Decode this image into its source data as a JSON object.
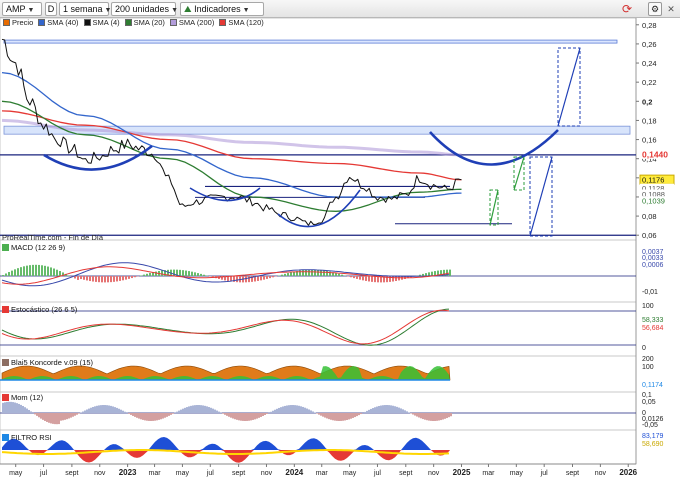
{
  "toolbar": {
    "ticker": "AMP",
    "d_label": "D",
    "period": "1 semana",
    "units": "200 unidades",
    "indicators": "Indicadores"
  },
  "legend": [
    {
      "label": "Precio",
      "color": "#e86b00"
    },
    {
      "label": "SMA (40)",
      "color": "#3366cc"
    },
    {
      "label": "SMA (4)",
      "color": "#111111"
    },
    {
      "label": "SMA (20)",
      "color": "#2e7d32"
    },
    {
      "label": "SMA (200)",
      "color": "#b39ddb"
    },
    {
      "label": "SMA (120)",
      "color": "#e53935"
    }
  ],
  "source_label": "ProRealTime.com - Fin de Día",
  "price_axis": {
    "ticks": [
      "0,28",
      "0,26",
      "0,24",
      "0,22",
      "0,2",
      "0,18",
      "0,16",
      "0,14",
      "0,12",
      "0,1",
      "0,08",
      "0,06"
    ],
    "tags": [
      {
        "text": "0,1440",
        "color": "#e53935",
        "bg": "#ffffff"
      },
      {
        "text": "0,1176",
        "color": "#111111",
        "bg": "#ffeb3b"
      },
      {
        "text": "0,1128",
        "color": "#555555",
        "bg": "#ffffff"
      },
      {
        "text": "0,1088",
        "color": "#555555",
        "bg": "#ffffff"
      },
      {
        "text": "0,1039",
        "color": "#2e7d32",
        "bg": "#ffffff"
      }
    ]
  },
  "x_axis": {
    "labels": [
      "may",
      "jul",
      "sept",
      "nov",
      "2023",
      "mar",
      "may",
      "jul",
      "sept",
      "nov",
      "2024",
      "mar",
      "may",
      "jul",
      "sept",
      "nov",
      "2025",
      "mar",
      "may",
      "jul",
      "sept",
      "nov",
      "2026"
    ]
  },
  "panels": {
    "macd": {
      "label": "MACD (12 26 9)",
      "ticks": [
        "0,0037",
        "0,0033",
        "0,0006",
        "-0,01"
      ]
    },
    "stoch": {
      "label": "Estocástico (26 6 5)",
      "ticks": [
        "100",
        "58,333",
        "56,684",
        "0"
      ]
    },
    "koncorde": {
      "label": "Blai5 Koncorde v.09 (15)",
      "ticks": [
        "200",
        "100",
        "0,1174"
      ]
    },
    "mom": {
      "label": "Mom (12)",
      "ticks": [
        "0,1",
        "0,05",
        "0",
        "0,0126",
        "-0,05"
      ]
    },
    "rsi": {
      "label": "FILTRO RSI",
      "ticks": [
        "83,179",
        "58,690"
      ]
    }
  },
  "chart_data": {
    "type": "line",
    "title": "AMP",
    "period": "1 semana",
    "x_range": [
      "2022-04",
      "2026-02"
    ],
    "ylim": [
      0.055,
      0.285
    ],
    "series": [
      {
        "name": "Precio",
        "x": [
          "2022-04",
          "2022-05",
          "2022-06",
          "2022-07",
          "2022-08",
          "2022-09",
          "2022-10",
          "2022-11",
          "2022-12",
          "2023-01",
          "2023-02",
          "2023-03",
          "2023-04",
          "2023-05",
          "2023-06",
          "2023-07",
          "2023-08",
          "2023-09",
          "2023-10",
          "2023-11",
          "2023-12",
          "2024-01",
          "2024-02",
          "2024-03",
          "2024-04",
          "2024-05",
          "2024-06",
          "2024-07",
          "2024-08",
          "2024-09",
          "2024-10",
          "2024-11",
          "2024-12",
          "2025-01"
        ],
        "values": [
          0.265,
          0.24,
          0.2,
          0.175,
          0.16,
          0.15,
          0.138,
          0.142,
          0.15,
          0.155,
          0.15,
          0.145,
          0.118,
          0.09,
          0.095,
          0.098,
          0.1,
          0.1,
          0.095,
          0.088,
          0.082,
          0.078,
          0.072,
          0.076,
          0.1,
          0.122,
          0.112,
          0.1,
          0.098,
          0.102,
          0.12,
          0.112,
          0.108,
          0.118
        ]
      },
      {
        "name": "SMA (40)",
        "x": [
          "2022-04",
          "2022-10",
          "2023-04",
          "2023-10",
          "2024-04",
          "2024-10",
          "2025-01"
        ],
        "values": [
          0.23,
          0.185,
          0.15,
          0.12,
          0.1,
          0.1,
          0.104
        ]
      },
      {
        "name": "SMA (20)",
        "x": [
          "2022-04",
          "2022-10",
          "2023-04",
          "2023-10",
          "2024-04",
          "2024-10",
          "2025-01"
        ],
        "values": [
          0.2,
          0.165,
          0.14,
          0.1,
          0.085,
          0.105,
          0.108
        ]
      },
      {
        "name": "SMA (120)",
        "x": [
          "2022-04",
          "2022-10",
          "2023-04",
          "2023-10",
          "2024-04",
          "2024-10",
          "2025-01"
        ],
        "values": [
          0.19,
          0.175,
          0.16,
          0.14,
          0.135,
          0.125,
          0.118
        ]
      },
      {
        "name": "SMA (200)",
        "x": [
          "2022-04",
          "2022-10",
          "2023-04",
          "2023-10",
          "2024-04",
          "2024-10",
          "2025-01"
        ],
        "values": [
          0.18,
          0.17,
          0.165,
          0.157,
          0.152,
          0.147,
          0.144
        ]
      }
    ],
    "horizontal_levels": [
      0.263,
      0.173,
      0.166,
      0.144,
      0.11,
      0.072,
      0.06
    ]
  }
}
